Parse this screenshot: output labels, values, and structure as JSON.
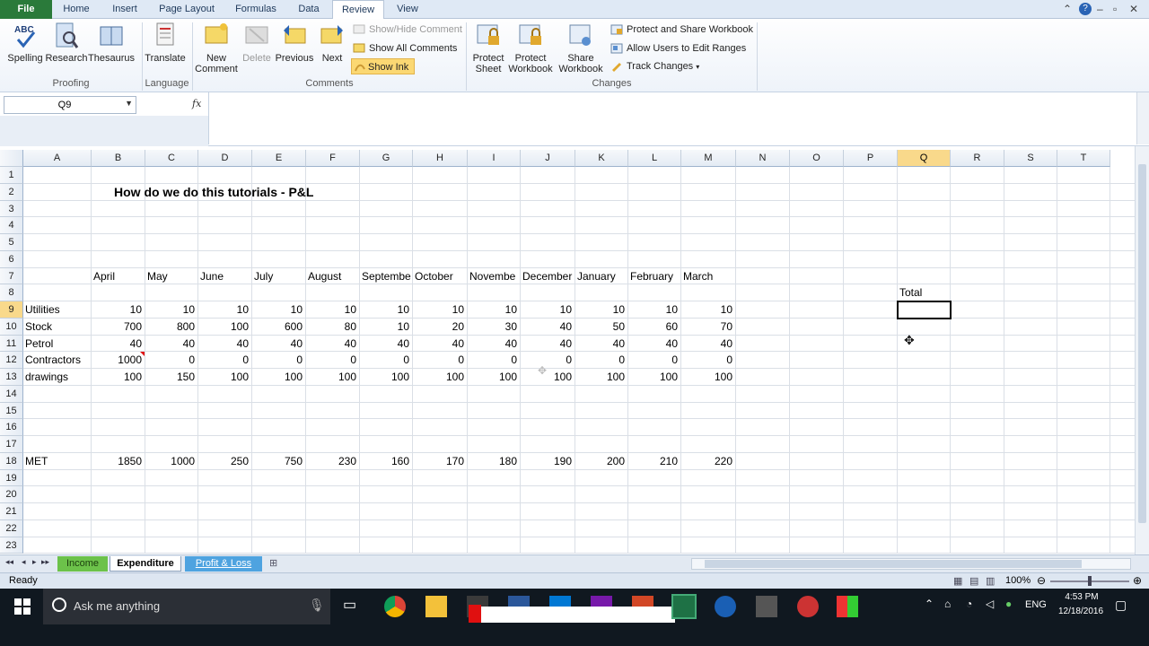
{
  "tabs": {
    "file": "File",
    "home": "Home",
    "insert": "Insert",
    "page_layout": "Page Layout",
    "formulas": "Formulas",
    "data": "Data",
    "review": "Review",
    "view": "View"
  },
  "ribbon": {
    "proofing": {
      "spelling": "Spelling",
      "research": "Research",
      "thesaurus": "Thesaurus",
      "label": "Proofing"
    },
    "language": {
      "translate": "Translate",
      "label": "Language"
    },
    "comments": {
      "new_comment_1": "New",
      "new_comment_2": "Comment",
      "delete": "Delete",
      "previous": "Previous",
      "next": "Next",
      "show_hide": "Show/Hide Comment",
      "show_all": "Show All Comments",
      "show_ink": "Show Ink",
      "label": "Comments"
    },
    "changes": {
      "protect_sheet_1": "Protect",
      "protect_sheet_2": "Sheet",
      "protect_wb_1": "Protect",
      "protect_wb_2": "Workbook",
      "share_wb_1": "Share",
      "share_wb_2": "Workbook",
      "protect_share": "Protect and Share Workbook",
      "allow_users": "Allow Users to Edit Ranges",
      "track_changes": "Track Changes",
      "label": "Changes"
    }
  },
  "formula_bar": {
    "name_box": "Q9",
    "fx": "fx",
    "formula": ""
  },
  "columns": [
    "A",
    "B",
    "C",
    "D",
    "E",
    "F",
    "G",
    "H",
    "I",
    "J",
    "K",
    "L",
    "M",
    "N",
    "O",
    "P",
    "Q",
    "R",
    "S",
    "T"
  ],
  "rows": [
    "1",
    "2",
    "3",
    "4",
    "5",
    "6",
    "7",
    "8",
    "9",
    "10",
    "11",
    "12",
    "13",
    "14",
    "15",
    "16",
    "17",
    "18",
    "19",
    "20",
    "21",
    "22",
    "23"
  ],
  "sheet": {
    "title": "How do we do this tutorials - P&L",
    "months": [
      "April",
      "May",
      "June",
      "July",
      "August",
      "Septembe",
      "October",
      "Novembe",
      "December",
      "January",
      "February",
      "March"
    ],
    "total_label": "Total",
    "row_labels": [
      "Utilities",
      "Stock",
      "Petrol",
      "Contractors",
      "drawings"
    ],
    "data": [
      [
        "10",
        "10",
        "10",
        "10",
        "10",
        "10",
        "10",
        "10",
        "10",
        "10",
        "10",
        "10"
      ],
      [
        "700",
        "800",
        "100",
        "600",
        "80",
        "10",
        "20",
        "30",
        "40",
        "50",
        "60",
        "70"
      ],
      [
        "40",
        "40",
        "40",
        "40",
        "40",
        "40",
        "40",
        "40",
        "40",
        "40",
        "40",
        "40"
      ],
      [
        "1000",
        "0",
        "0",
        "0",
        "0",
        "0",
        "0",
        "0",
        "0",
        "0",
        "0",
        "0"
      ],
      [
        "100",
        "150",
        "100",
        "100",
        "100",
        "100",
        "100",
        "100",
        "100",
        "100",
        "100",
        "100"
      ]
    ],
    "met_label": "MET",
    "met_values": [
      "1850",
      "1000",
      "250",
      "750",
      "230",
      "160",
      "170",
      "180",
      "190",
      "200",
      "210",
      "220"
    ]
  },
  "sheet_tabs": {
    "income": "Income",
    "expenditure": "Expenditure",
    "pl": "Profit & Loss"
  },
  "status": {
    "ready": "Ready",
    "zoom": "100%"
  },
  "taskbar": {
    "search": "Ask me anything",
    "lang": "ENG",
    "time": "4:53 PM",
    "date": "12/18/2016"
  },
  "colors": {
    "file_tab": "#2a7a3a",
    "selected_header": "#f9d98b",
    "income_tab": "#6cc24a",
    "pl_tab": "#4ea3e0"
  }
}
